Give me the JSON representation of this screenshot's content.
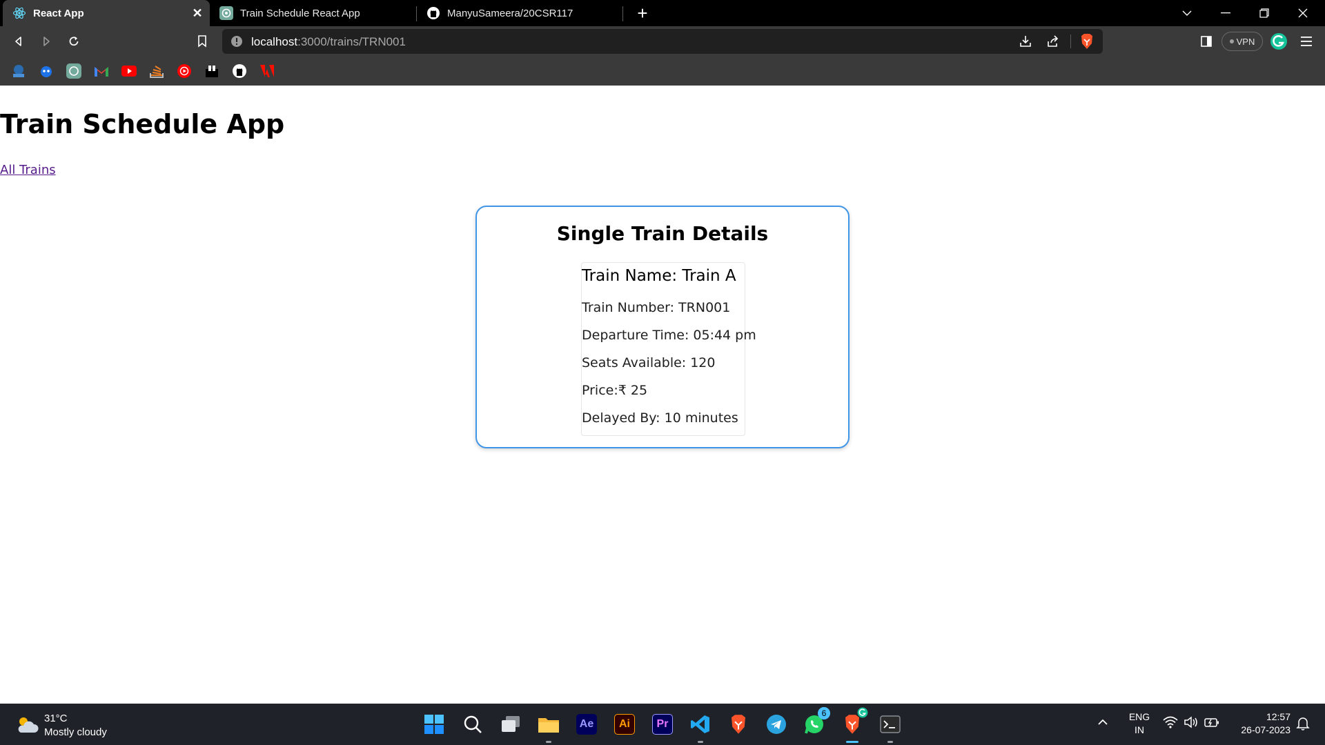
{
  "browser": {
    "tabs": [
      {
        "label": "React App",
        "icon": "react-icon",
        "active": true
      },
      {
        "label": "Train Schedule React App",
        "icon": "chatgpt-icon",
        "active": false
      },
      {
        "label": "ManyuSameera/20CSR117",
        "icon": "github-icon",
        "active": false
      }
    ],
    "new_tab_label": "+",
    "address": {
      "host": "localhost",
      "path": ":3000/trains/TRN001"
    },
    "vpn_label": "VPN",
    "bookmarks": [
      "site-icon",
      "bot-icon",
      "chatgpt-icon",
      "gmail-icon",
      "youtube-icon",
      "stack-icon",
      "youtube-music-icon",
      "unstop-icon",
      "github-icon",
      "adobe-icon"
    ]
  },
  "page": {
    "title": "Train Schedule App",
    "nav_link": "All Trains"
  },
  "card": {
    "heading": "Single Train Details",
    "train_name": "Train Name: Train A",
    "rows": [
      "Train Number: TRN001",
      "Departure Time: 05:44 pm",
      "Seats Available: 120",
      "Price:₹ 25",
      "Delayed By: 10 minutes"
    ]
  },
  "taskbar": {
    "weather": {
      "temp": "31°C",
      "condition": "Mostly cloudy"
    },
    "language": {
      "line1": "ENG",
      "line2": "IN"
    },
    "clock": {
      "time": "12:57",
      "date": "26-07-2023"
    },
    "whatsapp_badge": "6",
    "apps": [
      "windows-start-icon",
      "search-icon",
      "task-view-icon",
      "file-explorer-icon",
      "after-effects-icon",
      "illustrator-icon",
      "premiere-icon",
      "vscode-icon",
      "brave-icon",
      "telegram-icon",
      "whatsapp-icon",
      "brave-active-icon",
      "terminal-icon"
    ],
    "adobe_labels": {
      "ae": "Ae",
      "ai": "Ai",
      "pr": "Pr"
    }
  },
  "colors": {
    "card_border": "#3f96e8",
    "link": "#551a8b",
    "brave": "#fb542b"
  }
}
